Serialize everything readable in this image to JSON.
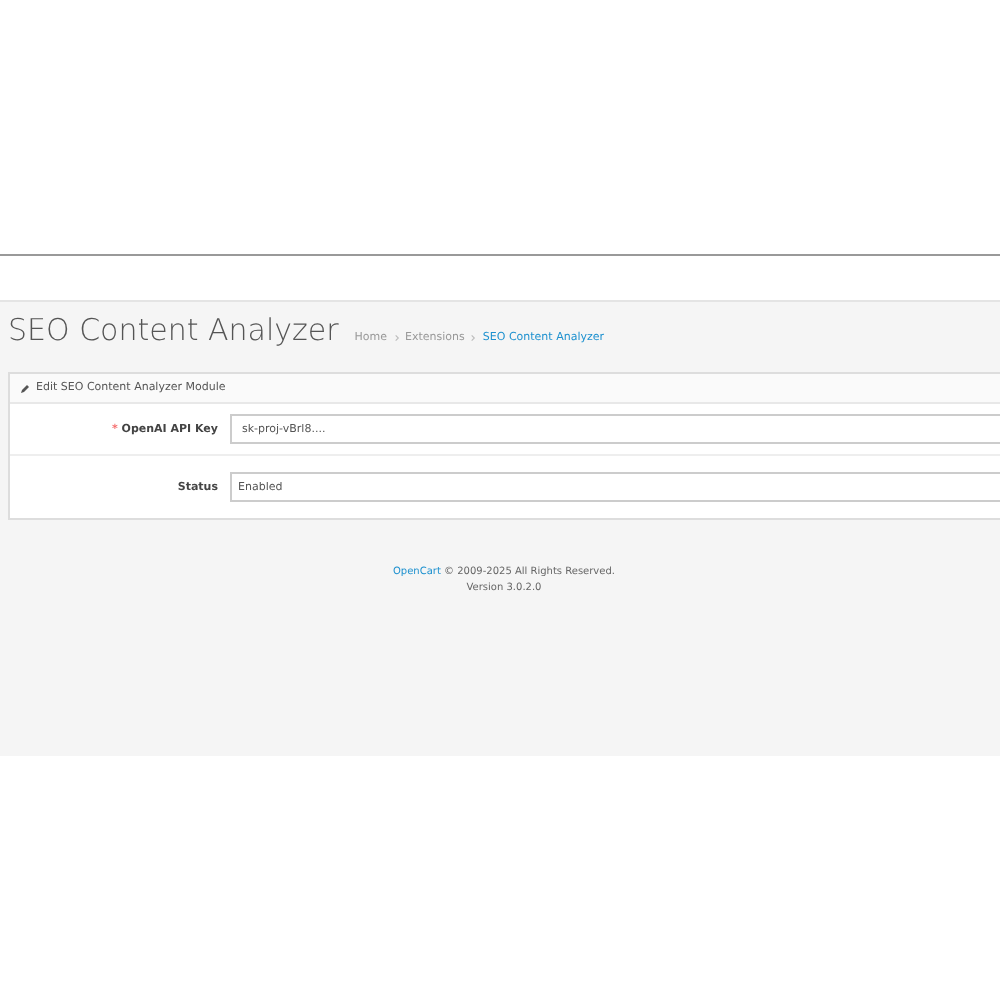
{
  "page_title": "SEO Content Analyzer",
  "breadcrumb": [
    {
      "label": "Home",
      "selected": false
    },
    {
      "label": "Extensions",
      "selected": false
    },
    {
      "label": "SEO Content Analyzer",
      "selected": true
    }
  ],
  "panel": {
    "title": "Edit SEO Content Analyzer Module",
    "fields": [
      {
        "kind": "input",
        "label": "OpenAI API Key",
        "required_mark": "*",
        "value": "sk-proj-vBrl8...."
      },
      {
        "kind": "select",
        "label": "Status",
        "value": "Enabled"
      }
    ]
  },
  "footer": {
    "link": "OpenCart",
    "text": "© 2009-2025 All Rights Reserved.",
    "version": "Version 3.0.2.0"
  }
}
